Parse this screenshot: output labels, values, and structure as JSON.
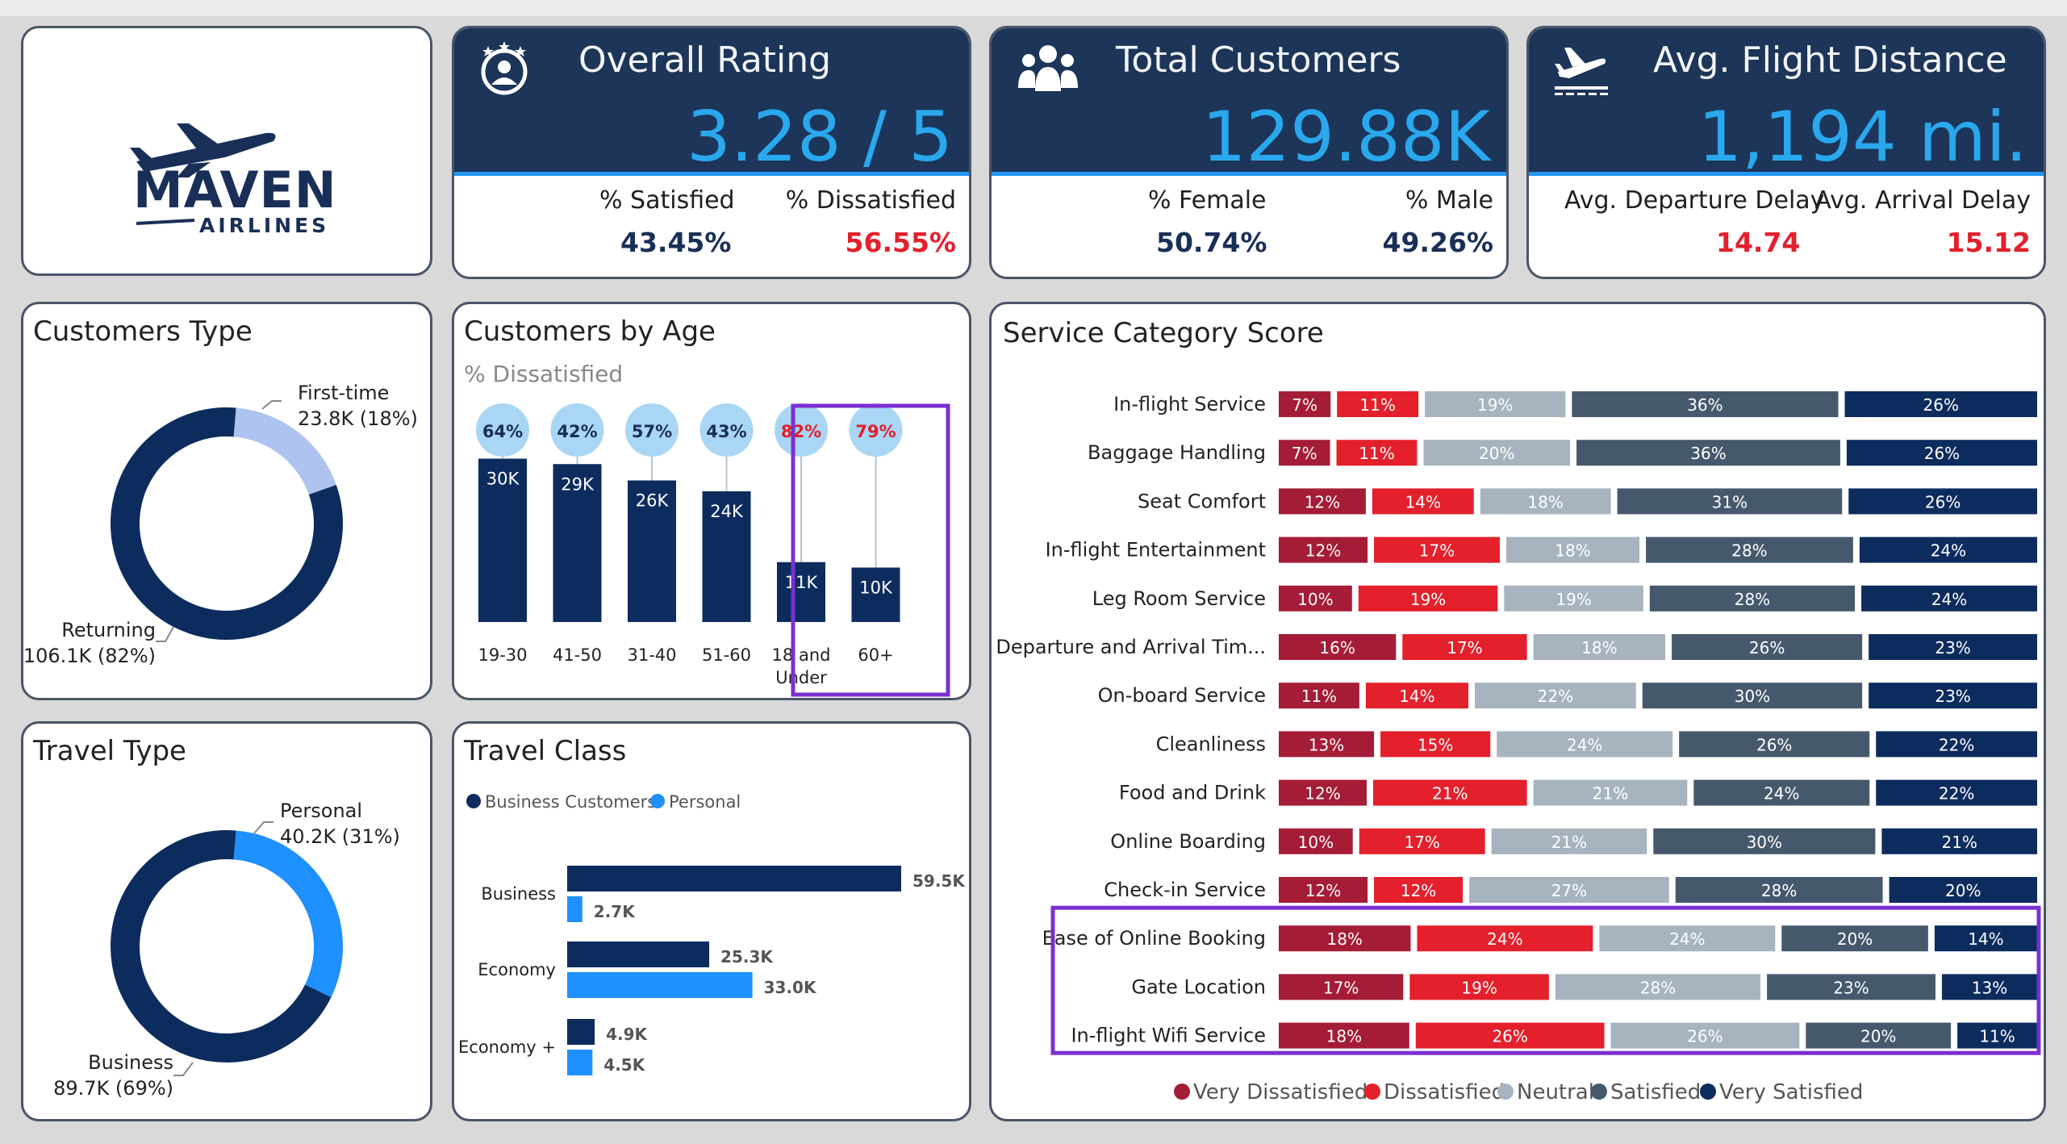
{
  "logo": {
    "word": "MAVEN",
    "sub": "AIRLINES"
  },
  "kpis": {
    "rating": {
      "title": "Overall Rating",
      "value": "3.28 / 5",
      "icon": "rating-stars-icon",
      "left_label": "% Satisfied",
      "left_value": "43.45%",
      "right_label": "% Dissatisfied",
      "right_value": "56.55%"
    },
    "customers": {
      "title": "Total Customers",
      "value": "129.88K",
      "icon": "people-icon",
      "left_label": "% Female",
      "left_value": "50.74%",
      "right_label": "% Male",
      "right_value": "49.26%"
    },
    "distance": {
      "title": "Avg. Flight Distance",
      "value": "1,194 mi.",
      "icon": "airplane-departure-icon",
      "left_label": "Avg. Departure Delay",
      "left_value": "14.74",
      "right_label": "Avg. Arrival Delay",
      "right_value": "15.12"
    }
  },
  "colors": {
    "navy": "#0d2c5e",
    "lightblue": "#aec3ef",
    "bright": "#1e90ff",
    "red": "#e3202b",
    "darkred": "#a51c36",
    "grey": "#a7b4bf",
    "slate": "#46596c",
    "highlight": "#7b2fd0"
  },
  "customers_type": {
    "title": "Customers Type",
    "labels": [
      {
        "name": "First-time",
        "value": "23.8K (18%)"
      },
      {
        "name": "Returning",
        "value": "106.1K (82%)"
      }
    ]
  },
  "travel_type": {
    "title": "Travel Type",
    "labels": [
      {
        "name": "Personal",
        "value": "40.2K (31%)"
      },
      {
        "name": "Business",
        "value": "89.7K (69%)"
      }
    ]
  },
  "age": {
    "title": "Customers by Age",
    "subtitle": "% Dissatisfied"
  },
  "travel_class": {
    "title": "Travel Class",
    "legend": [
      "Business Customers",
      "Personal"
    ]
  },
  "service": {
    "title": "Service Category Score",
    "legend": [
      "Very Dissatisfied",
      "Dissatisfied",
      "Neutral",
      "Satisfied",
      "Very Satisfied"
    ]
  },
  "chart_data": [
    {
      "type": "pie",
      "name": "Customers Type",
      "categories": [
        "First-time",
        "Returning"
      ],
      "values": [
        23.8,
        106.1
      ],
      "percent": [
        18,
        82
      ],
      "unit": "K"
    },
    {
      "type": "bar",
      "name": "Customers by Age",
      "categories": [
        "19-30",
        "41-50",
        "31-40",
        "51-60",
        "18 and Under",
        "60+"
      ],
      "values": [
        30,
        29,
        26,
        24,
        11,
        10
      ],
      "value_labels": [
        "30K",
        "29K",
        "26K",
        "24K",
        "11K",
        "10K"
      ],
      "dissatisfied_pct": [
        64,
        42,
        57,
        43,
        82,
        79
      ],
      "dissatisfied_labels": [
        "64%",
        "42%",
        "57%",
        "43%",
        "82%",
        "79%"
      ],
      "highlighted": [
        "18 and Under",
        "60+"
      ]
    },
    {
      "type": "pie",
      "name": "Travel Type",
      "categories": [
        "Personal",
        "Business"
      ],
      "values": [
        40.2,
        89.7
      ],
      "percent": [
        31,
        69
      ],
      "unit": "K"
    },
    {
      "type": "bar",
      "name": "Travel Class",
      "orientation": "horizontal",
      "categories": [
        "Business",
        "Economy",
        "Economy +"
      ],
      "series": [
        {
          "name": "Business Customers",
          "values": [
            59.5,
            25.3,
            4.9
          ],
          "labels": [
            "59.5K",
            "25.3K",
            "4.9K"
          ]
        },
        {
          "name": "Personal",
          "values": [
            2.7,
            33.0,
            4.5
          ],
          "labels": [
            "2.7K",
            "33.0K",
            "4.5K"
          ]
        }
      ]
    },
    {
      "type": "bar",
      "name": "Service Category Score",
      "orientation": "horizontal",
      "stacked": true,
      "categories": [
        "In-flight Service",
        "Baggage Handling",
        "Seat Comfort",
        "In-flight Entertainment",
        "Leg Room Service",
        "Departure and Arrival Tim...",
        "On-board Service",
        "Cleanliness",
        "Food and Drink",
        "Online Boarding",
        "Check-in Service",
        "Ease of Online Booking",
        "Gate Location",
        "In-flight Wifi Service"
      ],
      "series": [
        {
          "name": "Very Dissatisfied",
          "values": [
            7,
            7,
            12,
            12,
            10,
            16,
            11,
            13,
            12,
            10,
            12,
            18,
            17,
            18
          ]
        },
        {
          "name": "Dissatisfied",
          "values": [
            11,
            11,
            14,
            17,
            19,
            17,
            14,
            15,
            21,
            17,
            12,
            24,
            19,
            26
          ]
        },
        {
          "name": "Neutral",
          "values": [
            19,
            20,
            18,
            18,
            19,
            18,
            22,
            24,
            21,
            21,
            27,
            24,
            28,
            26
          ]
        },
        {
          "name": "Satisfied",
          "values": [
            36,
            36,
            31,
            28,
            28,
            26,
            30,
            26,
            24,
            30,
            28,
            20,
            23,
            20
          ]
        },
        {
          "name": "Very Satisfied",
          "values": [
            26,
            26,
            26,
            24,
            24,
            23,
            23,
            22,
            22,
            21,
            20,
            14,
            13,
            11
          ]
        }
      ],
      "highlighted": [
        "Ease of Online Booking",
        "Gate Location",
        "In-flight Wifi Service"
      ]
    }
  ]
}
